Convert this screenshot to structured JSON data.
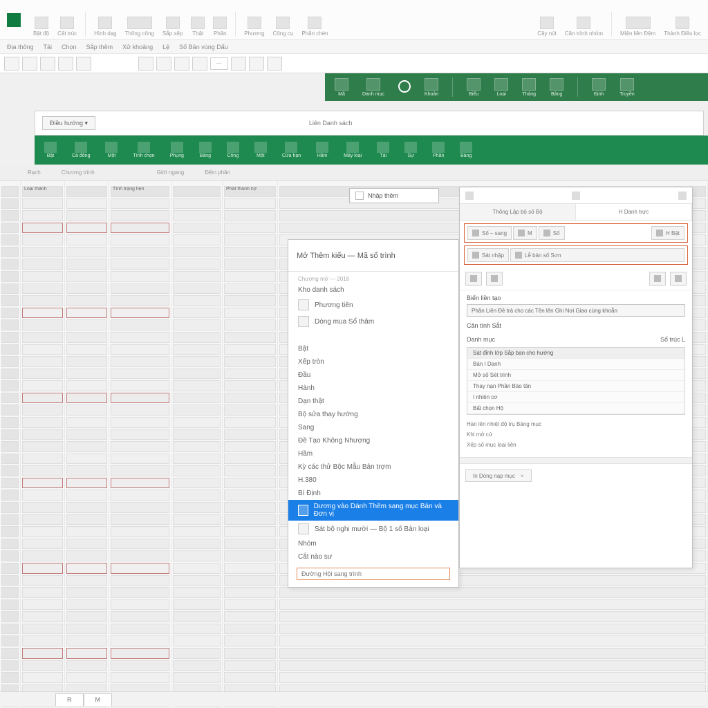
{
  "ribbon": {
    "groups": [
      {
        "label": "Bật độ"
      },
      {
        "label": "Cất trúc"
      },
      {
        "label": "Hình dạg"
      },
      {
        "label": "Thông công"
      },
      {
        "label": "Sắp xếp"
      },
      {
        "label": "Thật"
      },
      {
        "label": "Phần"
      },
      {
        "label": "Phương"
      },
      {
        "label": "Công cụ"
      },
      {
        "label": "Phần chèn"
      }
    ],
    "right": [
      {
        "label": "Cây nút"
      },
      {
        "label": "Căn trình nhỏm"
      },
      {
        "label": "Miện liên Đệm"
      },
      {
        "label": "Thành Điều lọc"
      }
    ]
  },
  "qat": [
    "Địa thông",
    "Tải",
    "Chọn",
    "Sắp thêm",
    "Xử khoảng",
    "Lệ",
    "Số Bản vùng Dấu"
  ],
  "greenBand": [
    {
      "label": "Mã"
    },
    {
      "label": "Danh mục"
    },
    {
      "label": ""
    },
    {
      "label": "Khoản"
    },
    {
      "label": "Biểu"
    },
    {
      "label": "Loại"
    },
    {
      "label": "Tháng"
    },
    {
      "label": "Bảng"
    },
    {
      "label": "Định"
    },
    {
      "label": "Truyền"
    }
  ],
  "docFrame": {
    "tab1": "Điều hướng",
    "tab2": "",
    "center": "Liên Danh sách"
  },
  "greenRibbon2": [
    {
      "label": "Bật"
    },
    {
      "label": "Cả đông"
    },
    {
      "label": "Một"
    },
    {
      "label": "Tính chọn"
    },
    {
      "label": "Phụng"
    },
    {
      "label": "Bảng"
    },
    {
      "label": "Công"
    },
    {
      "label": "Một"
    },
    {
      "label": "Cửa hạn"
    },
    {
      "label": "Hầm"
    },
    {
      "label": "Máy loại"
    },
    {
      "label": "Tải"
    },
    {
      "label": "Sự"
    },
    {
      "label": "Phần"
    },
    {
      "label": "Bảng"
    }
  ],
  "subTabs": [
    "Rạch",
    "Chương trính",
    "Giới ngang",
    "Đếm phân"
  ],
  "gridHeaders": [
    "Loại thành",
    "",
    "Tình trạng hẹn",
    "",
    "Phát thanh nợ"
  ],
  "smallDropdown": {
    "label": "Nhập thêm"
  },
  "dlgLeft": {
    "title": "Mở Thêm kiểu — Mã sổ trình",
    "group1Label": "Chương mở — 2018",
    "group1": [
      {
        "label": "Kho danh sách",
        "sel": false
      },
      {
        "label": "Phương tiên",
        "sel": false
      },
      {
        "label": "Dòng mua Sổ thâm",
        "sel": false
      }
    ],
    "group2": [
      {
        "label": "Bật"
      },
      {
        "label": "Xếp tròn"
      },
      {
        "label": "Đầu"
      },
      {
        "label": "Hành"
      },
      {
        "label": "Dạn thật"
      },
      {
        "label": "Bộ sửa thay hướng"
      },
      {
        "label": "Sang"
      },
      {
        "label": "Đề Tạo Không Nhượng"
      },
      {
        "label": "Hầm"
      },
      {
        "label": "Kỳ các thử Bộc Mẫu Bản trợm"
      },
      {
        "label": "H.380"
      },
      {
        "label": "Bí Định"
      },
      {
        "label": "Dương vào Dành Thêm sang mục Bản và Đơn vị",
        "sel": true
      },
      {
        "label": "Sát bộ nghi mười — Bộ 1 số Bản loại"
      },
      {
        "label": "Nhóm"
      },
      {
        "label": "Cắt nào sư"
      }
    ],
    "inputLabel": "Đường Hội sang trình",
    "inputValue": ""
  },
  "paneRight": {
    "tabs": [
      "Thống Lập bộ số  Bộ",
      "H Danh trực"
    ],
    "toolTop": [
      {
        "label": "Số – sang"
      },
      {
        "label": "M"
      },
      {
        "label": "Số"
      },
      {
        "label": "H Bật"
      }
    ],
    "toolMid": [
      {
        "label": "Sát nhập"
      },
      {
        "label": "Lễ bản số Sơn"
      }
    ],
    "secTitle": "Biến liền tạo",
    "comboValue": "Phân Liên Đề trả cho các Tên lên Ghi Nơi Giao cùng khoẳn",
    "secTitle2": "Căn tính Sắt",
    "catLabel": "Danh mục",
    "catSide": "Sổ trúc L",
    "listHeader": "Sát đỉnh lớp Sắp ban cho hướng",
    "listItems": [
      "Bản I Danh",
      "Mở số Sét trình",
      "Thay nạn Phần Bảo tăn",
      "I nhiên cơ",
      "Bất chọn Hộ"
    ],
    "extra": [
      "Hàn lên nhiệt độ trụ Bảng mục",
      "Khi mở cứ",
      "Xếp số mục loại liên"
    ],
    "miniTab": "In Dòng nạp mục",
    "ruler": true
  },
  "sheetTabs": [
    "R",
    "M"
  ]
}
